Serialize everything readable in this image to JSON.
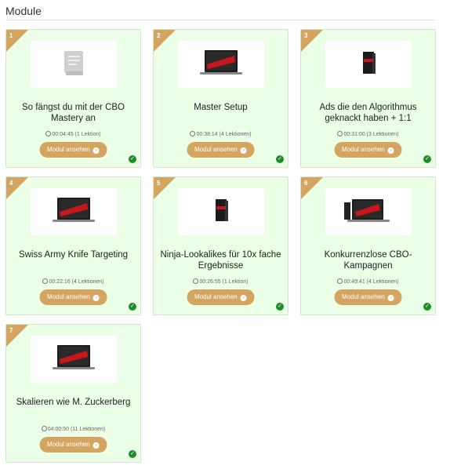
{
  "page": {
    "heading": "Module"
  },
  "modules": [
    {
      "number": "1",
      "title": "So fängst du mit der CBO Mastery an",
      "duration": "00:04:45 (1 Lektion)",
      "button": "Modul ansehen",
      "thumbnail": "book-icon",
      "completed": true
    },
    {
      "number": "2",
      "title": "Master Setup",
      "duration": "00:38:14 (4 Lektionen)",
      "button": "Modul ansehen",
      "thumbnail": "laptop-wide",
      "completed": true
    },
    {
      "number": "3",
      "title": "Ads die den Algorithmus geknackt haben + 1:1",
      "duration": "00:31:00 (3 Lektionen)",
      "button": "Modul ansehen",
      "thumbnail": "box-small",
      "completed": true
    },
    {
      "number": "4",
      "title": "Swiss Army Knife Targeting",
      "duration": "00:22:16 (4 Lektionen)",
      "button": "Modul ansehen",
      "thumbnail": "laptop",
      "completed": true
    },
    {
      "number": "5",
      "title": "Ninja-Lookalikes für 10x fache Ergebnisse",
      "duration": "00:26:55 (1 Lektion)",
      "button": "Modul ansehen",
      "thumbnail": "box-small",
      "completed": true
    },
    {
      "number": "6",
      "title": "Konkurrenzlose CBO-Kampagnen",
      "duration": "00:49:41 (4 Lektionen)",
      "button": "Modul ansehen",
      "thumbnail": "laptop-box",
      "completed": true
    },
    {
      "number": "7",
      "title": "Skalieren wie M. Zuckerberg",
      "duration": "04:00:50 (11 Lektionen)",
      "button": "Modul ansehen",
      "thumbnail": "laptop",
      "completed": true
    }
  ],
  "colors": {
    "card_bg": "#eaffe6",
    "accent": "#d3a560",
    "check": "#1e8c2a"
  }
}
